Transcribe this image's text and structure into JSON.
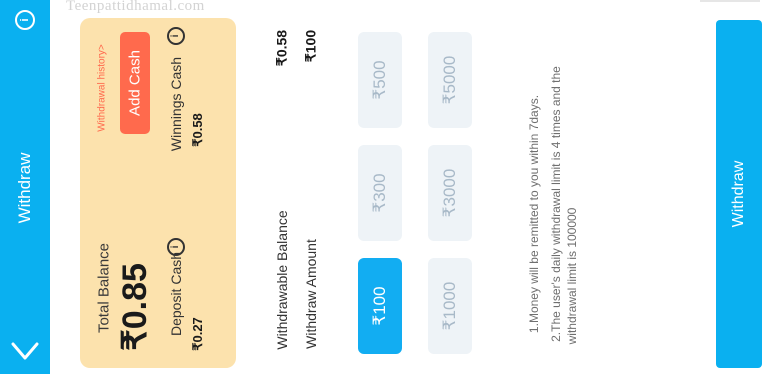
{
  "watermark": "Teenpattidhamal.com",
  "header": {
    "title": "Withdraw"
  },
  "balance_card": {
    "total_label": "Total Balance",
    "total_value": "₹0.85",
    "deposit_label": "Deposit Cash",
    "deposit_value": "₹0.27",
    "winnings_label": "Winnings Cash",
    "winnings_value": "₹0.58",
    "add_cash_label": "Add Cash",
    "history_link": "Withdrawal history>"
  },
  "withdraw_info": {
    "balance_label": "Withdrawable Balance",
    "balance_value": "₹0.58",
    "amount_label": "Withdraw Amount",
    "amount_value": "₹100"
  },
  "amount_options": {
    "o100": "₹100",
    "o300": "₹300",
    "o500": "₹500",
    "o1000": "₹1000",
    "o3000": "₹3000",
    "o5000": "₹5000",
    "selected": "₹100"
  },
  "notes": {
    "n1": "1.Money will be remitted to you within 7days.",
    "n2a": "2.The user's daily withdrawal limit is 4 times and the",
    "n2b": "withdrawal limit is 100000"
  },
  "action": {
    "withdraw_label": "Withdraw"
  },
  "colors": {
    "accent": "#0ab0f0",
    "card": "#fce2ad",
    "add_cash": "#ff6a4d",
    "history": "#ff6a4d"
  },
  "icons": {
    "back": "chevron-down-icon",
    "info": "info-icon"
  }
}
